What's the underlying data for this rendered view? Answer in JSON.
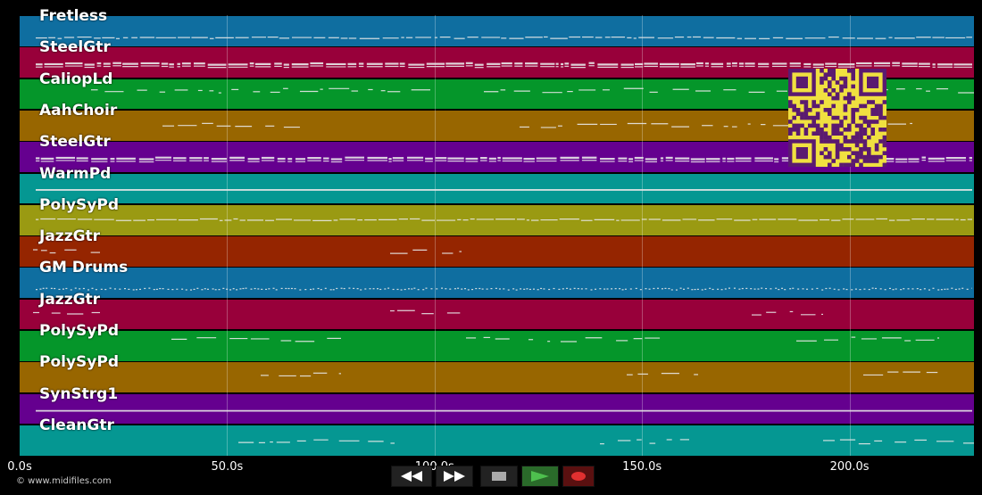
{
  "tracks": [
    {
      "name": "Fretless",
      "color": "#0f6ea0"
    },
    {
      "name": "SteelGtr",
      "color": "#98003a"
    },
    {
      "name": "CaliopLd",
      "color": "#05962a"
    },
    {
      "name": "AahChoir",
      "color": "#986600"
    },
    {
      "name": "SteelGtr",
      "color": "#65008f"
    },
    {
      "name": "WarmPd",
      "color": "#059792"
    },
    {
      "name": "PolySyPd",
      "color": "#9a9a12"
    },
    {
      "name": "JazzGtr",
      "color": "#952500"
    },
    {
      "name": "GM Drums",
      "color": "#0f6ea0"
    },
    {
      "name": "JazzGtr",
      "color": "#98003a"
    },
    {
      "name": "PolySyPd",
      "color": "#05962a"
    },
    {
      "name": "PolySyPd",
      "color": "#986600"
    },
    {
      "name": "SynStrg1",
      "color": "#65008f"
    },
    {
      "name": "CleanGtr",
      "color": "#059792"
    }
  ],
  "timeline": {
    "ticks": [
      {
        "value": 0,
        "label": "0.0s"
      },
      {
        "value": 50,
        "label": "50.0s"
      },
      {
        "value": 100,
        "label": "100.0s"
      },
      {
        "value": 150,
        "label": "150.0s"
      },
      {
        "value": 200,
        "label": "200.0s"
      }
    ],
    "max_seconds": 230
  },
  "copyright": "© www.midifiles.com",
  "transport": {
    "buttons": [
      {
        "name": "rewind-button",
        "icon": "rewind-icon"
      },
      {
        "name": "fast-forward-button",
        "icon": "fast-forward-icon"
      },
      {
        "name": "stop-button",
        "icon": "stop-icon"
      },
      {
        "name": "play-button",
        "icon": "play-icon"
      },
      {
        "name": "record-button",
        "icon": "record-icon"
      }
    ]
  },
  "qr": {
    "icon": "qr-code-icon",
    "color": "#5a1a70",
    "background": "#f0e040"
  }
}
